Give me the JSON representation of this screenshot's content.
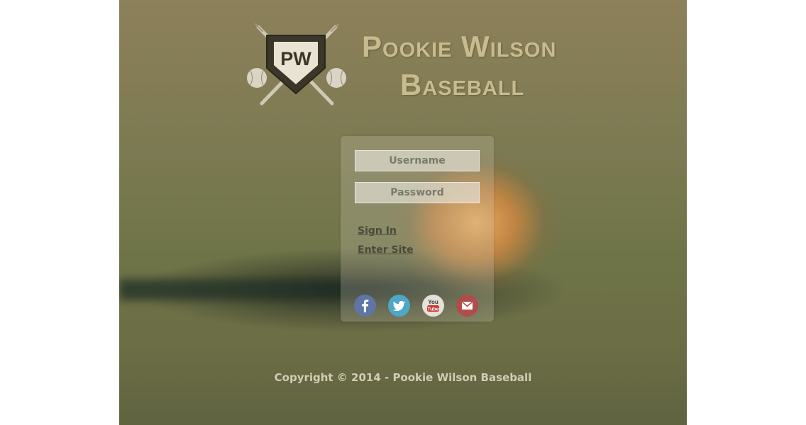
{
  "brand": {
    "logo_monogram": "PW",
    "title_line1": "Pookie Wilson",
    "title_line2": "Baseball"
  },
  "login": {
    "username_placeholder": "Username",
    "password_placeholder": "Password",
    "sign_in_label": "Sign In",
    "enter_site_label": "Enter Site"
  },
  "social": {
    "icons": [
      "facebook-icon",
      "twitter-icon",
      "youtube-icon",
      "email-icon"
    ],
    "youtube_text_1": "You",
    "youtube_text_2": "Tube",
    "colors": {
      "facebook": "#5d76a6",
      "twitter": "#4da7c8",
      "youtube": "#e4e1d9",
      "email": "#b04d4a"
    }
  },
  "footer": {
    "copyright": "Copyright © 2014 - Pookie Wilson Baseball"
  }
}
